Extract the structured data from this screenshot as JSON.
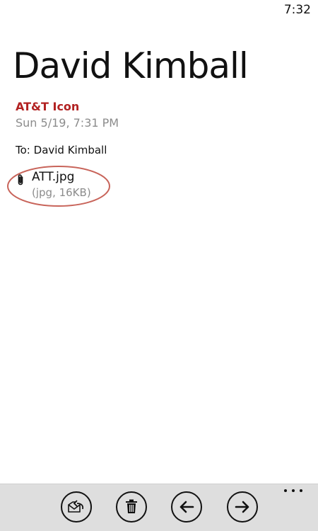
{
  "status_bar": {
    "time": "7:32"
  },
  "message": {
    "sender": "David Kimball",
    "subject": "AT&T Icon",
    "date": "Sun 5/19, 7:31 PM",
    "to_label": "To:",
    "to_name": "David Kimball",
    "attachment": {
      "icon": "paperclip-icon",
      "name": "ATT.jpg",
      "meta": "(jpg, 16KB)"
    }
  },
  "app_bar": {
    "buttons": [
      {
        "icon": "reply-icon"
      },
      {
        "icon": "delete-icon"
      },
      {
        "icon": "previous-arrow-icon"
      },
      {
        "icon": "next-arrow-icon"
      }
    ],
    "more_icon": "more-icon"
  },
  "colors": {
    "accent": "#b22222",
    "secondary_text": "#8c8c8c",
    "app_bar_bg": "#dedede",
    "highlight_ring": "#c8645a"
  }
}
